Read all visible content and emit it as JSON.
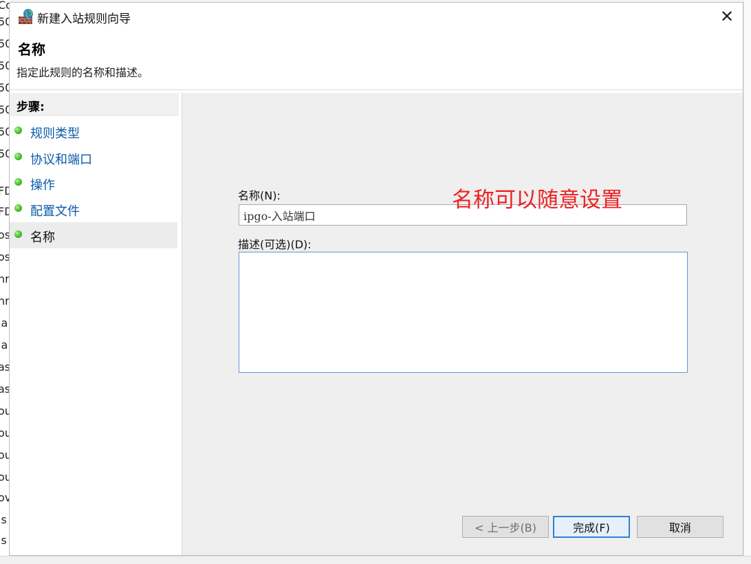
{
  "background_window": {
    "left_fragments": [
      "Со",
      "50",
      "50",
      "50",
      "50",
      "50",
      "50",
      "50",
      "FD",
      "FD",
      "os",
      "os",
      "hr",
      "hr",
      "la",
      "la",
      "as",
      "as",
      "ou",
      "ou",
      "ou",
      "ou",
      "ov",
      "is",
      "is"
    ]
  },
  "dialog": {
    "title": "新建入站规则向导",
    "close_glyph": "✕",
    "header": {
      "title": "名称",
      "description": "指定此规则的名称和描述。"
    },
    "steps": {
      "heading": "步骤:",
      "items": [
        {
          "label": "规则类型",
          "active": false
        },
        {
          "label": "协议和端口",
          "active": false
        },
        {
          "label": "操作",
          "active": false
        },
        {
          "label": "配置文件",
          "active": false
        },
        {
          "label": "名称",
          "active": true
        }
      ]
    },
    "form": {
      "name_label": "名称(N):",
      "name_value": "ipgo-入站端口",
      "description_label": "描述(可选)(D):",
      "description_value": ""
    },
    "annotation": "名称可以随意设置",
    "buttons": {
      "back": "< 上一步(B)",
      "finish": "完成(F)",
      "cancel": "取消"
    }
  },
  "colors": {
    "step_dot": "#55c636",
    "step_link": "#0a5aa8",
    "annotation": "#ee2222",
    "primary_button_border": "#2f7fd1",
    "input_focus_border": "#5b9bd5"
  }
}
